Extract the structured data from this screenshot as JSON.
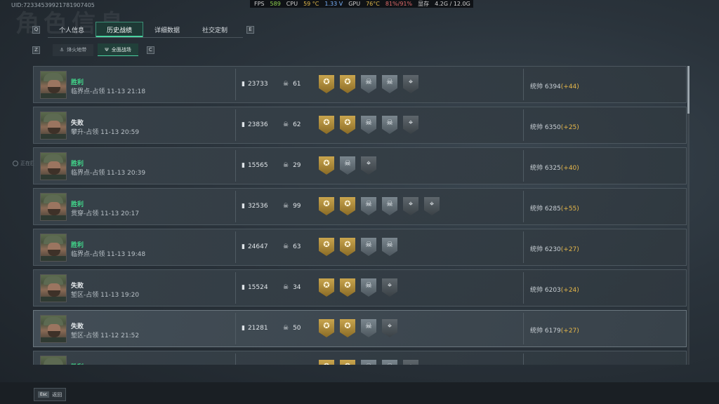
{
  "background_title": "角色信息",
  "uid": "UID:72334539921781907405",
  "perf": {
    "fps_label": "FPS",
    "fps": "589",
    "cpu_label": "CPU",
    "cpu_temp": "59 °C",
    "cpu_volt": "1.33 V",
    "gpu_label": "GPU",
    "gpu_temp": "76°C",
    "gpu_usage": "81%/91%",
    "vram_label": "显存",
    "vram": "4.2G / 12.0G"
  },
  "tabs": {
    "key_left": "Q",
    "key_right": "E",
    "items": [
      {
        "label": "个人信息"
      },
      {
        "label": "历史战绩"
      },
      {
        "label": "详细数据"
      },
      {
        "label": "社交定制"
      }
    ],
    "active_index": 1
  },
  "subtabs": {
    "key_left": "Z",
    "key_right": "C",
    "items": [
      {
        "label": "烽火地带"
      },
      {
        "label": "全面战场"
      }
    ],
    "active_index": 1
  },
  "side_badge": "正在匹",
  "matches": [
    {
      "result": "胜利",
      "outcome": "win",
      "map": "临界点-占领",
      "time": "11-13 21:18",
      "score": "23733",
      "kills": "61",
      "medals": [
        "gold",
        "gold",
        "silver",
        "silver",
        "dark"
      ],
      "rating": "统帅 6394",
      "delta": "(+44)"
    },
    {
      "result": "失败",
      "outcome": "lose",
      "map": "攀升-占领",
      "time": "11-13 20:59",
      "score": "23836",
      "kills": "62",
      "medals": [
        "gold",
        "gold",
        "silver",
        "silver",
        "dark"
      ],
      "rating": "统帅 6350",
      "delta": "(+25)"
    },
    {
      "result": "胜利",
      "outcome": "win",
      "map": "临界点-占领",
      "time": "11-13 20:39",
      "score": "15565",
      "kills": "29",
      "medals": [
        "gold",
        "silver",
        "dark"
      ],
      "rating": "统帅 6325",
      "delta": "(+40)"
    },
    {
      "result": "胜利",
      "outcome": "win",
      "map": "贯穿-占领",
      "time": "11-13 20:17",
      "score": "32536",
      "kills": "99",
      "medals": [
        "gold",
        "gold",
        "silver",
        "silver",
        "dark",
        "dark"
      ],
      "rating": "统帅 6285",
      "delta": "(+55)"
    },
    {
      "result": "胜利",
      "outcome": "win",
      "map": "临界点-占领",
      "time": "11-13 19:48",
      "score": "24647",
      "kills": "63",
      "medals": [
        "gold",
        "gold",
        "silver",
        "silver"
      ],
      "rating": "统帅 6230",
      "delta": "(+27)"
    },
    {
      "result": "失败",
      "outcome": "lose",
      "map": "堑区-占领",
      "time": "11-13 19:20",
      "score": "15524",
      "kills": "34",
      "medals": [
        "gold",
        "gold",
        "silver",
        "dark"
      ],
      "rating": "统帅 6203",
      "delta": "(+24)"
    },
    {
      "result": "失败",
      "outcome": "lose",
      "map": "堑区-占领",
      "time": "11-12 21:52",
      "score": "21281",
      "kills": "50",
      "medals": [
        "gold",
        "gold",
        "silver",
        "dark"
      ],
      "rating": "统帅 6179",
      "delta": "(+27)"
    },
    {
      "result": "胜利",
      "outcome": "win",
      "map": "",
      "time": "",
      "score": "",
      "kills": "",
      "medals": [
        "gold",
        "gold",
        "silver",
        "silver",
        "dark"
      ],
      "rating": "",
      "delta": ""
    }
  ],
  "medal_glyphs": {
    "gold": "✪",
    "silver": "☠",
    "dark": "⌖"
  },
  "icons": {
    "score": "bar-chart-icon",
    "kills": "skull-icon"
  },
  "footer": {
    "key": "Esc",
    "label": "返回"
  }
}
